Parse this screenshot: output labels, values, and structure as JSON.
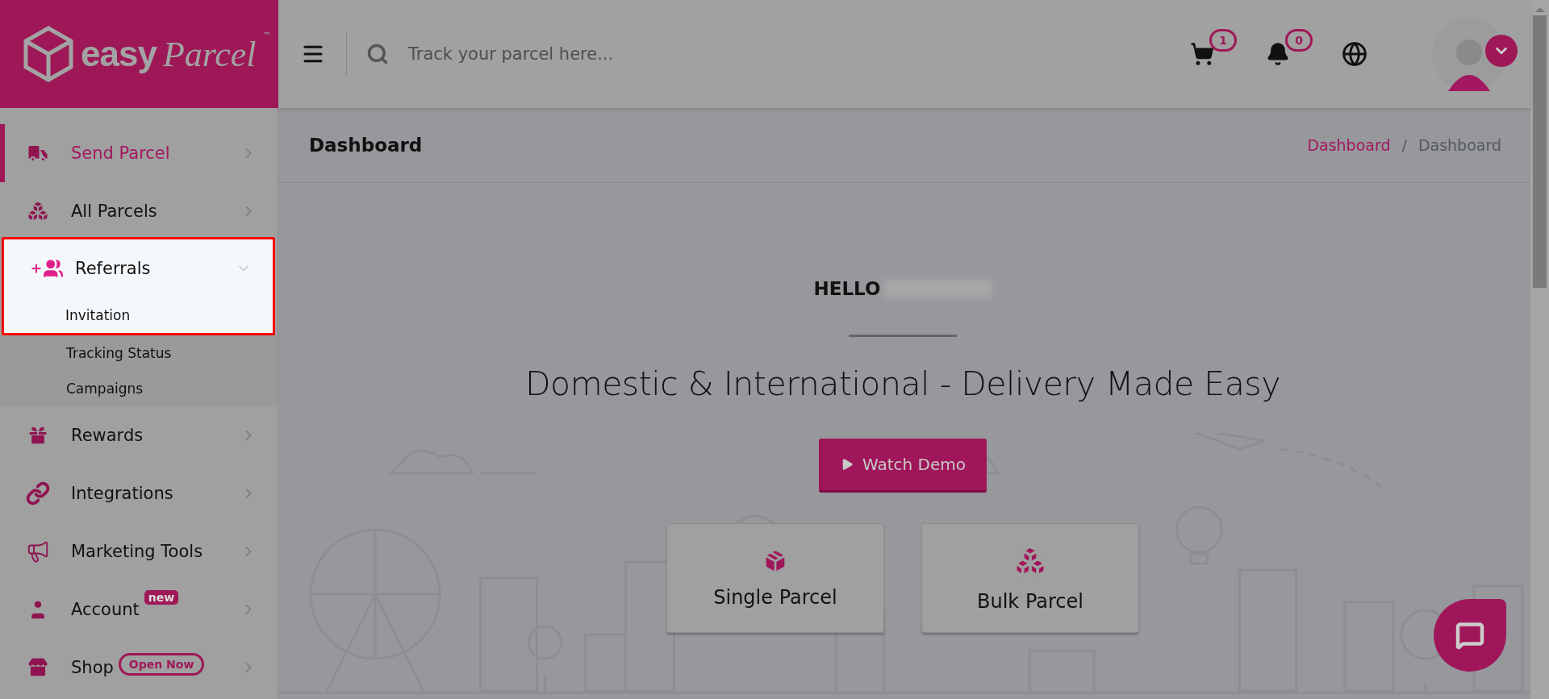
{
  "header": {
    "logo": {
      "word": "easy",
      "script": "Parcel",
      "mark": "™"
    },
    "search": {
      "placeholder": "Track your parcel here..."
    },
    "cart": {
      "count": "1"
    },
    "notifications": {
      "count": "0"
    }
  },
  "sidebar": {
    "items": [
      {
        "label": "Send Parcel",
        "selected": true,
        "expanded": false,
        "highlighted": false
      },
      {
        "label": "All Parcels",
        "selected": false,
        "expanded": false,
        "highlighted": false
      },
      {
        "label": "Referrals",
        "selected": false,
        "expanded": true,
        "highlighted": true,
        "children": [
          {
            "label": "Invitation",
            "highlighted": true
          },
          {
            "label": "Tracking Status",
            "highlighted": false
          },
          {
            "label": "Campaigns",
            "highlighted": false
          }
        ]
      },
      {
        "label": "Rewards",
        "selected": false,
        "expanded": false,
        "highlighted": false
      },
      {
        "label": "Integrations",
        "selected": false,
        "expanded": false,
        "highlighted": false
      },
      {
        "label": "Marketing Tools",
        "selected": false,
        "expanded": false,
        "highlighted": false
      },
      {
        "label": "Account",
        "selected": false,
        "expanded": false,
        "highlighted": false,
        "badge": {
          "text": "new",
          "kind": "filled"
        }
      },
      {
        "label": "Shop",
        "selected": false,
        "expanded": false,
        "highlighted": false,
        "badge": {
          "text": "Open Now",
          "kind": "outline"
        }
      }
    ]
  },
  "page": {
    "title": "Dashboard",
    "breadcrumb_separator": "/",
    "breadcrumb": [
      {
        "label": "Dashboard",
        "kind": "link"
      },
      {
        "label": "Dashboard",
        "kind": "current"
      }
    ]
  },
  "hero": {
    "greeting": "HELLO",
    "name_redacted": true,
    "headline": "Domestic & International - Delivery Made Easy",
    "button": "Watch Demo",
    "cards": [
      {
        "label": "Single Parcel",
        "kind": "single"
      },
      {
        "label": "Bulk Parcel",
        "kind": "bulk"
      }
    ]
  }
}
